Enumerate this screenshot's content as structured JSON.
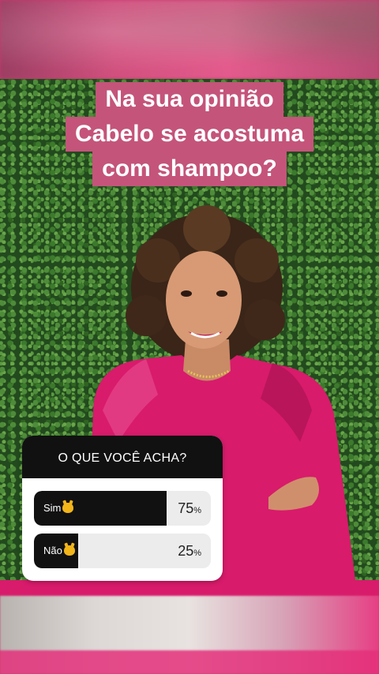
{
  "story": {
    "question_lines": [
      "Na sua opinião",
      "Cabelo se acostuma",
      "com shampoo?"
    ]
  },
  "poll": {
    "title": "O QUE VOCÊ ACHA?",
    "options": [
      {
        "label": "Sim",
        "percent": 75,
        "percent_text": "75",
        "emoji": "cat-hiding-icon"
      },
      {
        "label": "Não",
        "percent": 25,
        "percent_text": "25",
        "emoji": "cat-hiding-icon"
      }
    ],
    "percent_sign": "%"
  },
  "colors": {
    "title_bg": "#c4547a",
    "band": "#d81b6b",
    "blouse": "#d81b6b",
    "poll_fill": "#111111"
  }
}
